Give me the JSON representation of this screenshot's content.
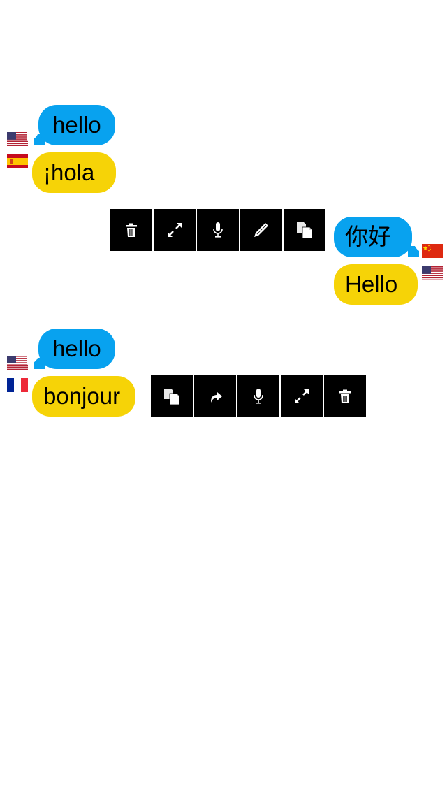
{
  "colors": {
    "source_bubble": "#08a2ef",
    "translation_bubble": "#f6d307",
    "toolbar_button": "#000000",
    "icon": "#ffffff"
  },
  "conversation": [
    {
      "source": {
        "text": "hello",
        "language_flag": "us-flag-icon",
        "side": "left"
      },
      "translation": {
        "text": "¡hola",
        "language_flag": "es-flag-icon",
        "side": "left"
      }
    },
    {
      "source": {
        "text": "你好",
        "language_flag": "cn-flag-icon",
        "side": "right"
      },
      "translation": {
        "text": "Hello",
        "language_flag": "us-flag-icon",
        "side": "right"
      },
      "toolbar": [
        "trash-icon",
        "expand-icon",
        "microphone-icon",
        "pencil-icon",
        "copy-icon"
      ]
    },
    {
      "source": {
        "text": "hello",
        "language_flag": "us-flag-icon",
        "side": "left"
      },
      "translation": {
        "text": "bonjour",
        "language_flag": "fr-flag-icon",
        "side": "left"
      },
      "toolbar": [
        "copy-icon",
        "share-icon",
        "microphone-icon",
        "expand-icon",
        "trash-icon"
      ]
    }
  ]
}
